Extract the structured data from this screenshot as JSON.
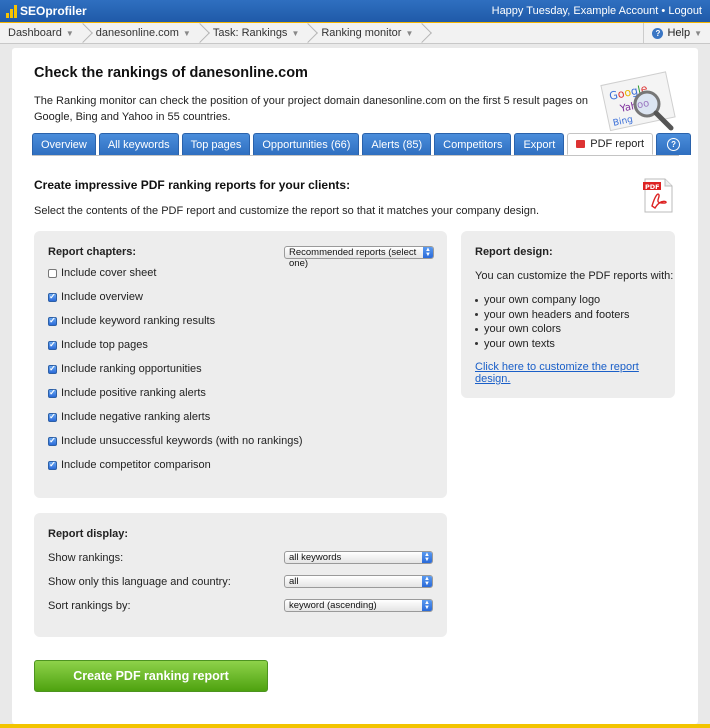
{
  "app": {
    "logo_text": "SEOprofiler",
    "greeting": "Happy Tuesday, Example Account",
    "logout": "Logout",
    "greeting_separator": "•"
  },
  "breadcrumb": [
    {
      "label": "Dashboard"
    },
    {
      "label": "danesonline.com"
    },
    {
      "label": "Task: Rankings"
    },
    {
      "label": "Ranking monitor"
    }
  ],
  "help_label": "Help",
  "page": {
    "title": "Check the rankings of danesonline.com",
    "intro": "The Ranking monitor can check the position of your project domain danesonline.com on the first 5 result pages on Google, Bing and Yahoo in 55 countries."
  },
  "tabs": [
    {
      "label": "Overview"
    },
    {
      "label": "All keywords"
    },
    {
      "label": "Top pages"
    },
    {
      "label": "Opportunities (66)"
    },
    {
      "label": "Alerts (85)"
    },
    {
      "label": "Competitors"
    },
    {
      "label": "Export"
    },
    {
      "label": "PDF report",
      "active": true
    }
  ],
  "section": {
    "heading": "Create impressive PDF ranking reports for your clients:",
    "subtext": "Select the contents of the PDF report and customize the report so that it matches your company design."
  },
  "chapters": {
    "title": "Report chapters:",
    "preset_select": "Recommended reports (select one)",
    "items": [
      {
        "label": "Include cover sheet",
        "checked": false
      },
      {
        "label": "Include overview",
        "checked": true
      },
      {
        "label": "Include keyword ranking results",
        "checked": true
      },
      {
        "label": "Include top pages",
        "checked": true
      },
      {
        "label": "Include ranking opportunities",
        "checked": true
      },
      {
        "label": "Include positive ranking alerts",
        "checked": true
      },
      {
        "label": "Include negative ranking alerts",
        "checked": true
      },
      {
        "label": "Include unsuccessful keywords (with no rankings)",
        "checked": true
      },
      {
        "label": "Include competitor comparison",
        "checked": true
      }
    ]
  },
  "design": {
    "title": "Report design:",
    "intro": "You can customize the PDF reports with:",
    "bullets": [
      "your own company logo",
      "your own headers and footers",
      "your own colors",
      "your own texts"
    ],
    "link": "Click here to customize the report design."
  },
  "display": {
    "title": "Report display:",
    "rows": [
      {
        "label": "Show rankings:",
        "value": "all keywords"
      },
      {
        "label": "Show only this language and country:",
        "value": "all"
      },
      {
        "label": "Sort rankings by:",
        "value": "keyword (ascending)"
      }
    ]
  },
  "create_button": "Create PDF ranking report",
  "colors": {
    "topbar": "#2f6fc0",
    "tab": "#3a7fd2",
    "button": "#6bbd2b",
    "accent_stripe": "#f2c400"
  }
}
